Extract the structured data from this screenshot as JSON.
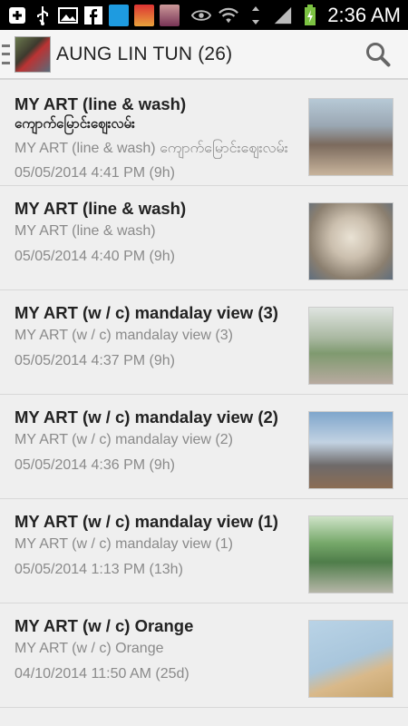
{
  "status_bar": {
    "time": "2:36 AM",
    "left_icons": [
      "plus-box-icon",
      "usb-icon",
      "image-icon",
      "facebook-icon",
      "app-icon-1",
      "app-icon-2",
      "app-icon-3"
    ],
    "right_icons": [
      "eye-icon",
      "wifi-icon",
      "data-arrows-icon",
      "signal-icon",
      "battery-charging-icon"
    ],
    "colors": {
      "background": "#000000",
      "battery": "#7cc242"
    }
  },
  "header": {
    "title": "AUNG LIN TUN (26)",
    "search_icon": "search-icon"
  },
  "posts": [
    {
      "title": "MY ART (line & wash)",
      "subtitle": "ကျောက်မြောင်းဈေးလမ်း",
      "desc": "MY ART (line & wash) ကျောက်မြောင်းဈေးလမ်း",
      "time": "05/05/2014 4:41 PM (9h)"
    },
    {
      "title": "MY ART (line & wash)",
      "desc": "MY ART (line & wash)",
      "time": "05/05/2014 4:40 PM (9h)"
    },
    {
      "title": "MY ART (w / c) mandalay view (3)",
      "desc": "MY ART (w / c) mandalay view (3)",
      "time": "05/05/2014 4:37 PM (9h)"
    },
    {
      "title": "MY ART (w / c) mandalay view (2)",
      "desc": "MY ART (w / c) mandalay view (2)",
      "time": "05/05/2014 4:36 PM (9h)"
    },
    {
      "title": "MY ART (w / c) mandalay view (1)",
      "desc": "MY ART (w / c) mandalay view (1)",
      "time": "05/05/2014 1:13 PM (13h)"
    },
    {
      "title": "MY ART (w / c) Orange",
      "desc": "MY ART (w / c) Orange",
      "time": "04/10/2014 11:50 AM (25d)"
    }
  ]
}
